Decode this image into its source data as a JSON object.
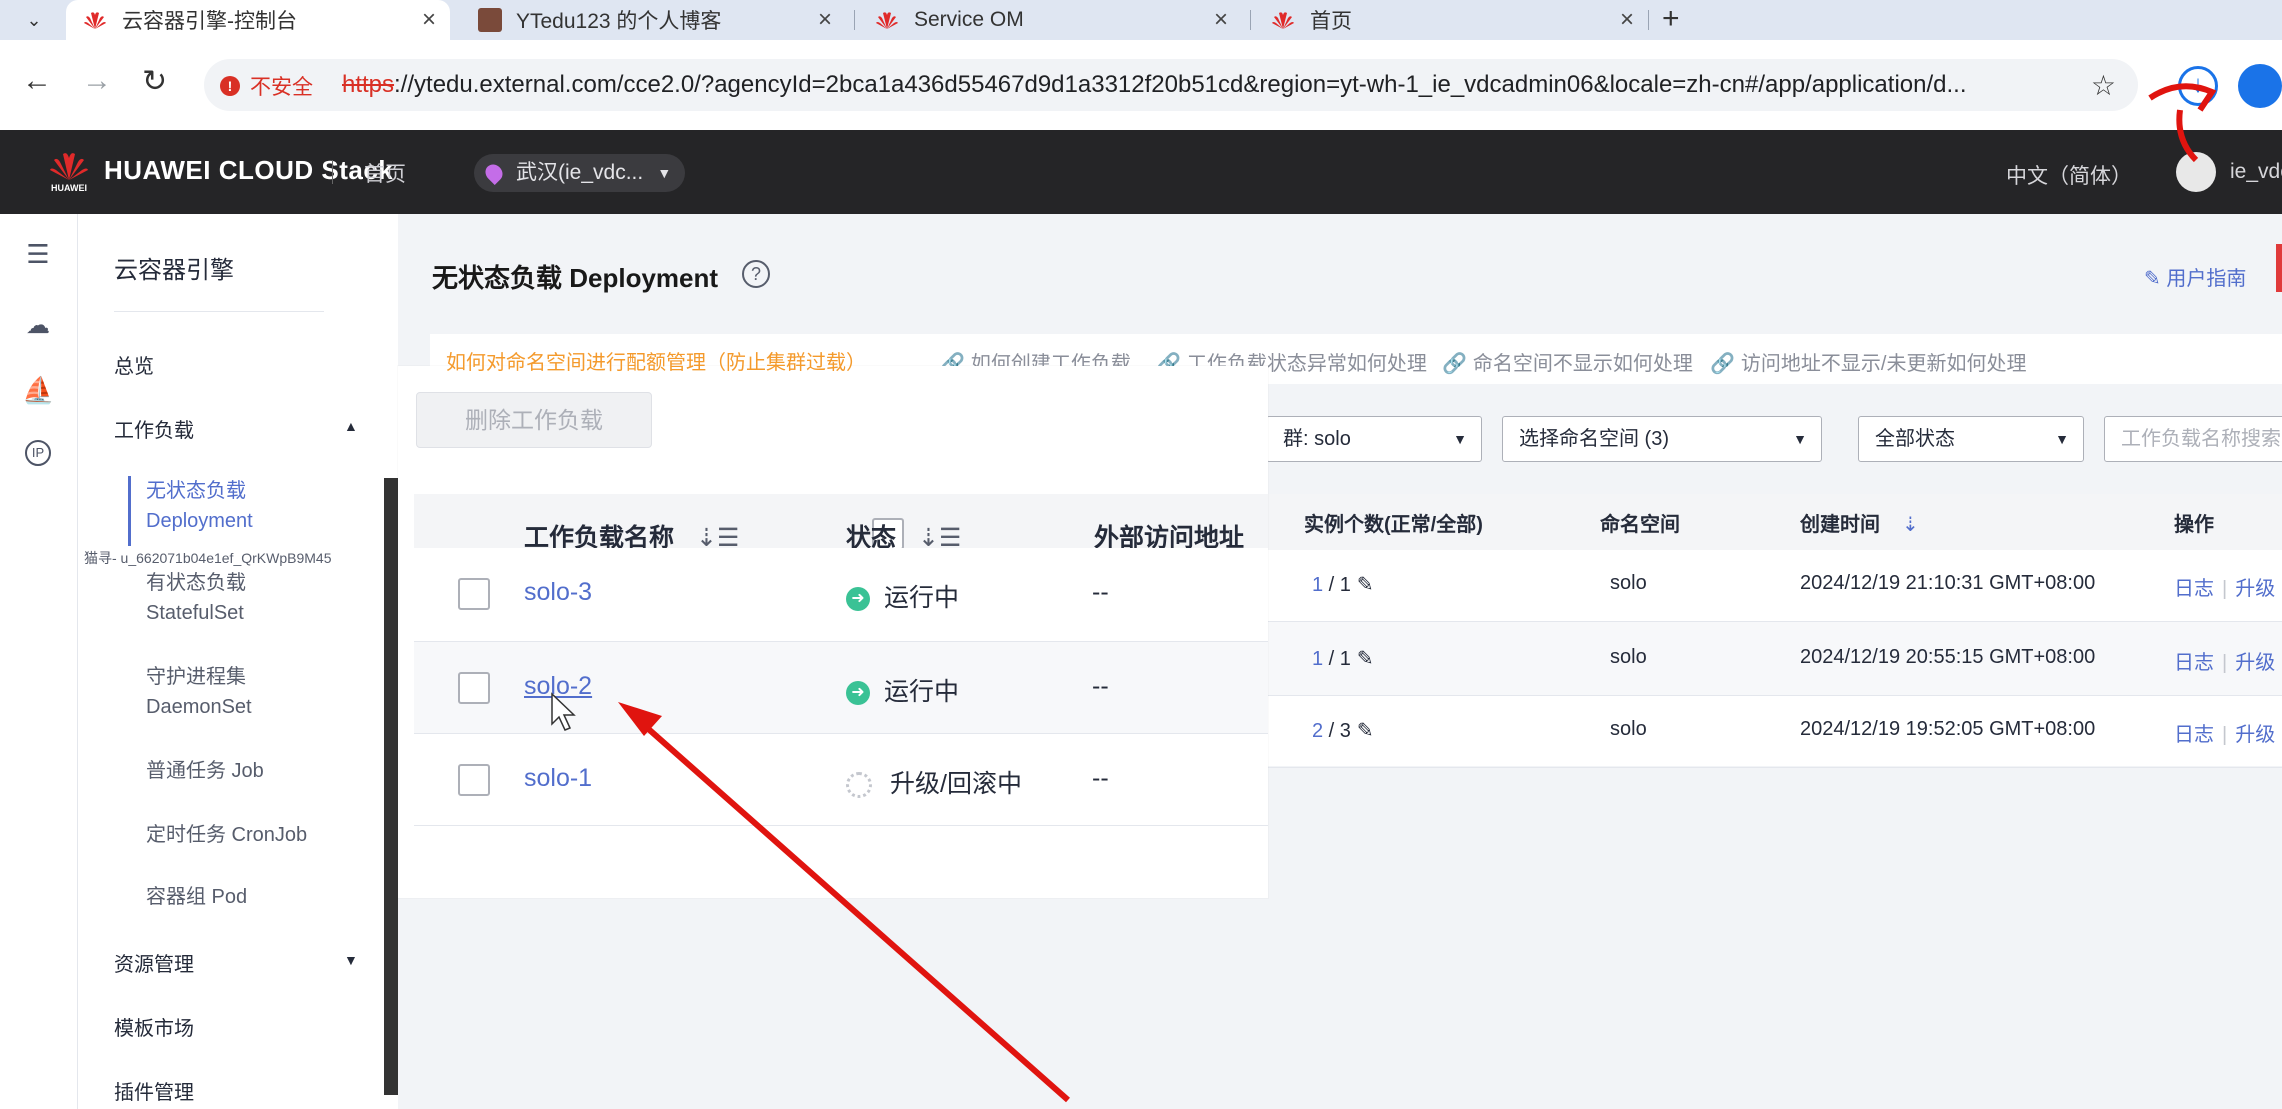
{
  "browser": {
    "tabs": [
      {
        "title": "云容器引擎-控制台",
        "active": true
      },
      {
        "title": "YTedu123 的个人博客",
        "active": false
      },
      {
        "title": "Service OM",
        "active": false
      },
      {
        "title": "首页",
        "active": false
      }
    ],
    "insecure_label": "不安全",
    "url_proto": "https",
    "url_rest": "://ytedu.external.com/cce2.0/?agencyId=2bca1a436d55467d9d1a3312f20b51cd&region=yt-wh-1_ie_vdcadmin06&locale=zh-cn#/app/application/d..."
  },
  "header": {
    "brand": "HUAWEI CLOUD Stack",
    "brand_small": "HUAWEI",
    "home": "首页",
    "region": "武汉(ie_vdc...",
    "lang": "中文（简体）",
    "user": "ie_vdc"
  },
  "sidebar": {
    "title": "云容器引擎",
    "items": {
      "overview": "总览",
      "workload": "工作负载",
      "deployment_cn": "无状态负载",
      "deployment_en": "Deployment",
      "statefulset_cn": "有状态负载",
      "statefulset_en": "StatefulSet",
      "daemonset_cn": "守护进程集",
      "daemonset_en": "DaemonSet",
      "job": "普通任务 Job",
      "cronjob": "定时任务 CronJob",
      "pod": "容器组 Pod",
      "resources": "资源管理",
      "templates": "模板市场",
      "plugins": "插件管理"
    },
    "tooltip": "猫寻- u_662071b04e1ef_QrKWpB9M45"
  },
  "main": {
    "title": "无状态负载 Deployment",
    "guide": "用户指南",
    "tips": [
      "如何对命名空间进行配额管理（防止集群过载）",
      "如何创建工作负载",
      "工作负载状态异常如何处理",
      "命名空间不显示如何处理",
      "访问地址不显示/未更新如何处理"
    ],
    "delete_button": "删除工作负载",
    "filters": {
      "cluster_prefix": "群: ",
      "cluster": "solo",
      "namespace": "选择命名空间 (3)",
      "status": "全部状态",
      "search_placeholder": "工作负载名称搜索"
    },
    "columns": {
      "name": "工作负载名称",
      "status": "状态",
      "access": "外部访问地址",
      "instances": "实例个数(正常/全部)",
      "namespace": "命名空间",
      "created": "创建时间",
      "ops": "操作"
    },
    "rows": [
      {
        "name": "solo-3",
        "status": "运行中",
        "access": "--",
        "ready": "1",
        "total": "1",
        "namespace": "solo",
        "created": "2024/12/19 21:10:31 GMT+08:00",
        "op_log": "日志",
        "op_upgrade": "升级"
      },
      {
        "name": "solo-2",
        "status": "运行中",
        "access": "--",
        "ready": "1",
        "total": "1",
        "namespace": "solo",
        "created": "2024/12/19 20:55:15 GMT+08:00",
        "op_log": "日志",
        "op_upgrade": "升级"
      },
      {
        "name": "solo-1",
        "status": "升级/回滚中",
        "access": "--",
        "ready": "2",
        "total": "3",
        "namespace": "solo",
        "created": "2024/12/19 19:52:05 GMT+08:00",
        "op_log": "日志",
        "op_upgrade": "升级"
      }
    ]
  },
  "colors": {
    "accent": "#526ecc",
    "running": "#3ac295",
    "warning": "#f49a2c",
    "annotation": "#e0140f"
  }
}
